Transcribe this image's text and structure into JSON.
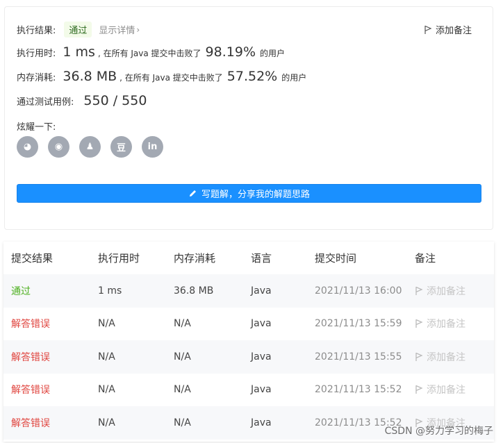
{
  "result": {
    "exec_label": "执行结果:",
    "status_badge": "通过",
    "detail_link": "显示详情",
    "detail_chevron": "›",
    "add_note": "添加备注",
    "runtime_label": "执行用时:",
    "runtime_value": "1 ms",
    "runtime_mid": ", 在所有 Java 提交中击败了",
    "runtime_pct": "98.19%",
    "runtime_tail": "的用户",
    "memory_label": "内存消耗:",
    "memory_value": "36.8 MB",
    "memory_mid": ", 在所有 Java 提交中击败了",
    "memory_pct": "57.52%",
    "memory_tail": "的用户",
    "cases_label": "通过测试用例:",
    "cases_value": "550 / 550",
    "share_label": "炫耀一下:",
    "share_icons": [
      {
        "name": "wechat-icon",
        "glyph": "◕"
      },
      {
        "name": "weibo-icon",
        "glyph": "◉"
      },
      {
        "name": "qq-icon",
        "glyph": "♟"
      },
      {
        "name": "douban-icon",
        "glyph": "豆"
      },
      {
        "name": "linkedin-icon",
        "glyph": "in"
      }
    ],
    "write_solution": "写题解，分享我的解题思路"
  },
  "table": {
    "headers": [
      "提交结果",
      "执行用时",
      "内存消耗",
      "语言",
      "提交时间",
      "备注"
    ],
    "rows": [
      {
        "status": "通过",
        "status_type": "ok",
        "runtime": "1 ms",
        "memory": "36.8 MB",
        "lang": "Java",
        "time": "2021/11/13 16:00",
        "note": "添加备注"
      },
      {
        "status": "解答错误",
        "status_type": "err",
        "runtime": "N/A",
        "memory": "N/A",
        "lang": "Java",
        "time": "2021/11/13 15:59",
        "note": "添加备注"
      },
      {
        "status": "解答错误",
        "status_type": "err",
        "runtime": "N/A",
        "memory": "N/A",
        "lang": "Java",
        "time": "2021/11/13 15:55",
        "note": "添加备注"
      },
      {
        "status": "解答错误",
        "status_type": "err",
        "runtime": "N/A",
        "memory": "N/A",
        "lang": "Java",
        "time": "2021/11/13 15:52",
        "note": "添加备注"
      },
      {
        "status": "解答错误",
        "status_type": "err",
        "runtime": "N/A",
        "memory": "N/A",
        "lang": "Java",
        "time": "2021/11/13 15:52",
        "note": "添加备注"
      }
    ]
  },
  "watermark": "CSDN @努力学习的梅子",
  "colors": {
    "accent": "#1a90ff",
    "success": "#4caf1e",
    "error": "#e0453f",
    "share_icon_bg": "#a3a9b3"
  }
}
